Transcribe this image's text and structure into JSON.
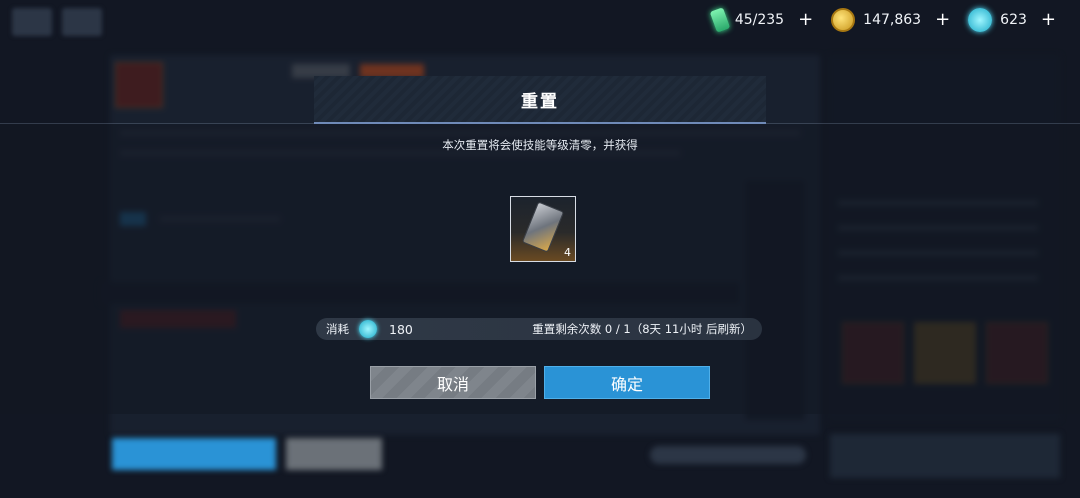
{
  "resources": [
    {
      "icon": "energy-icon",
      "value": "45/235",
      "plus": "+"
    },
    {
      "icon": "coin-icon",
      "value": "147,863",
      "plus": "+"
    },
    {
      "icon": "gem-icon",
      "value": "623",
      "plus": "+"
    }
  ],
  "dialog": {
    "title": "重置",
    "description": "本次重置将会使技能等级清零，并获得",
    "reward_item": {
      "icon": "chip-item-icon",
      "quantity": "4"
    },
    "cost": {
      "label": "消耗",
      "currency_icon": "gem-icon",
      "amount": "180",
      "remaining": "重置剩余次数 0 / 1（8天 11小时 后刷新）"
    },
    "buttons": {
      "cancel": "取消",
      "confirm": "确定"
    }
  },
  "colors": {
    "accent": "#2a93d6",
    "cancel": "#7f858c",
    "header_border": "#6f8ab8"
  }
}
